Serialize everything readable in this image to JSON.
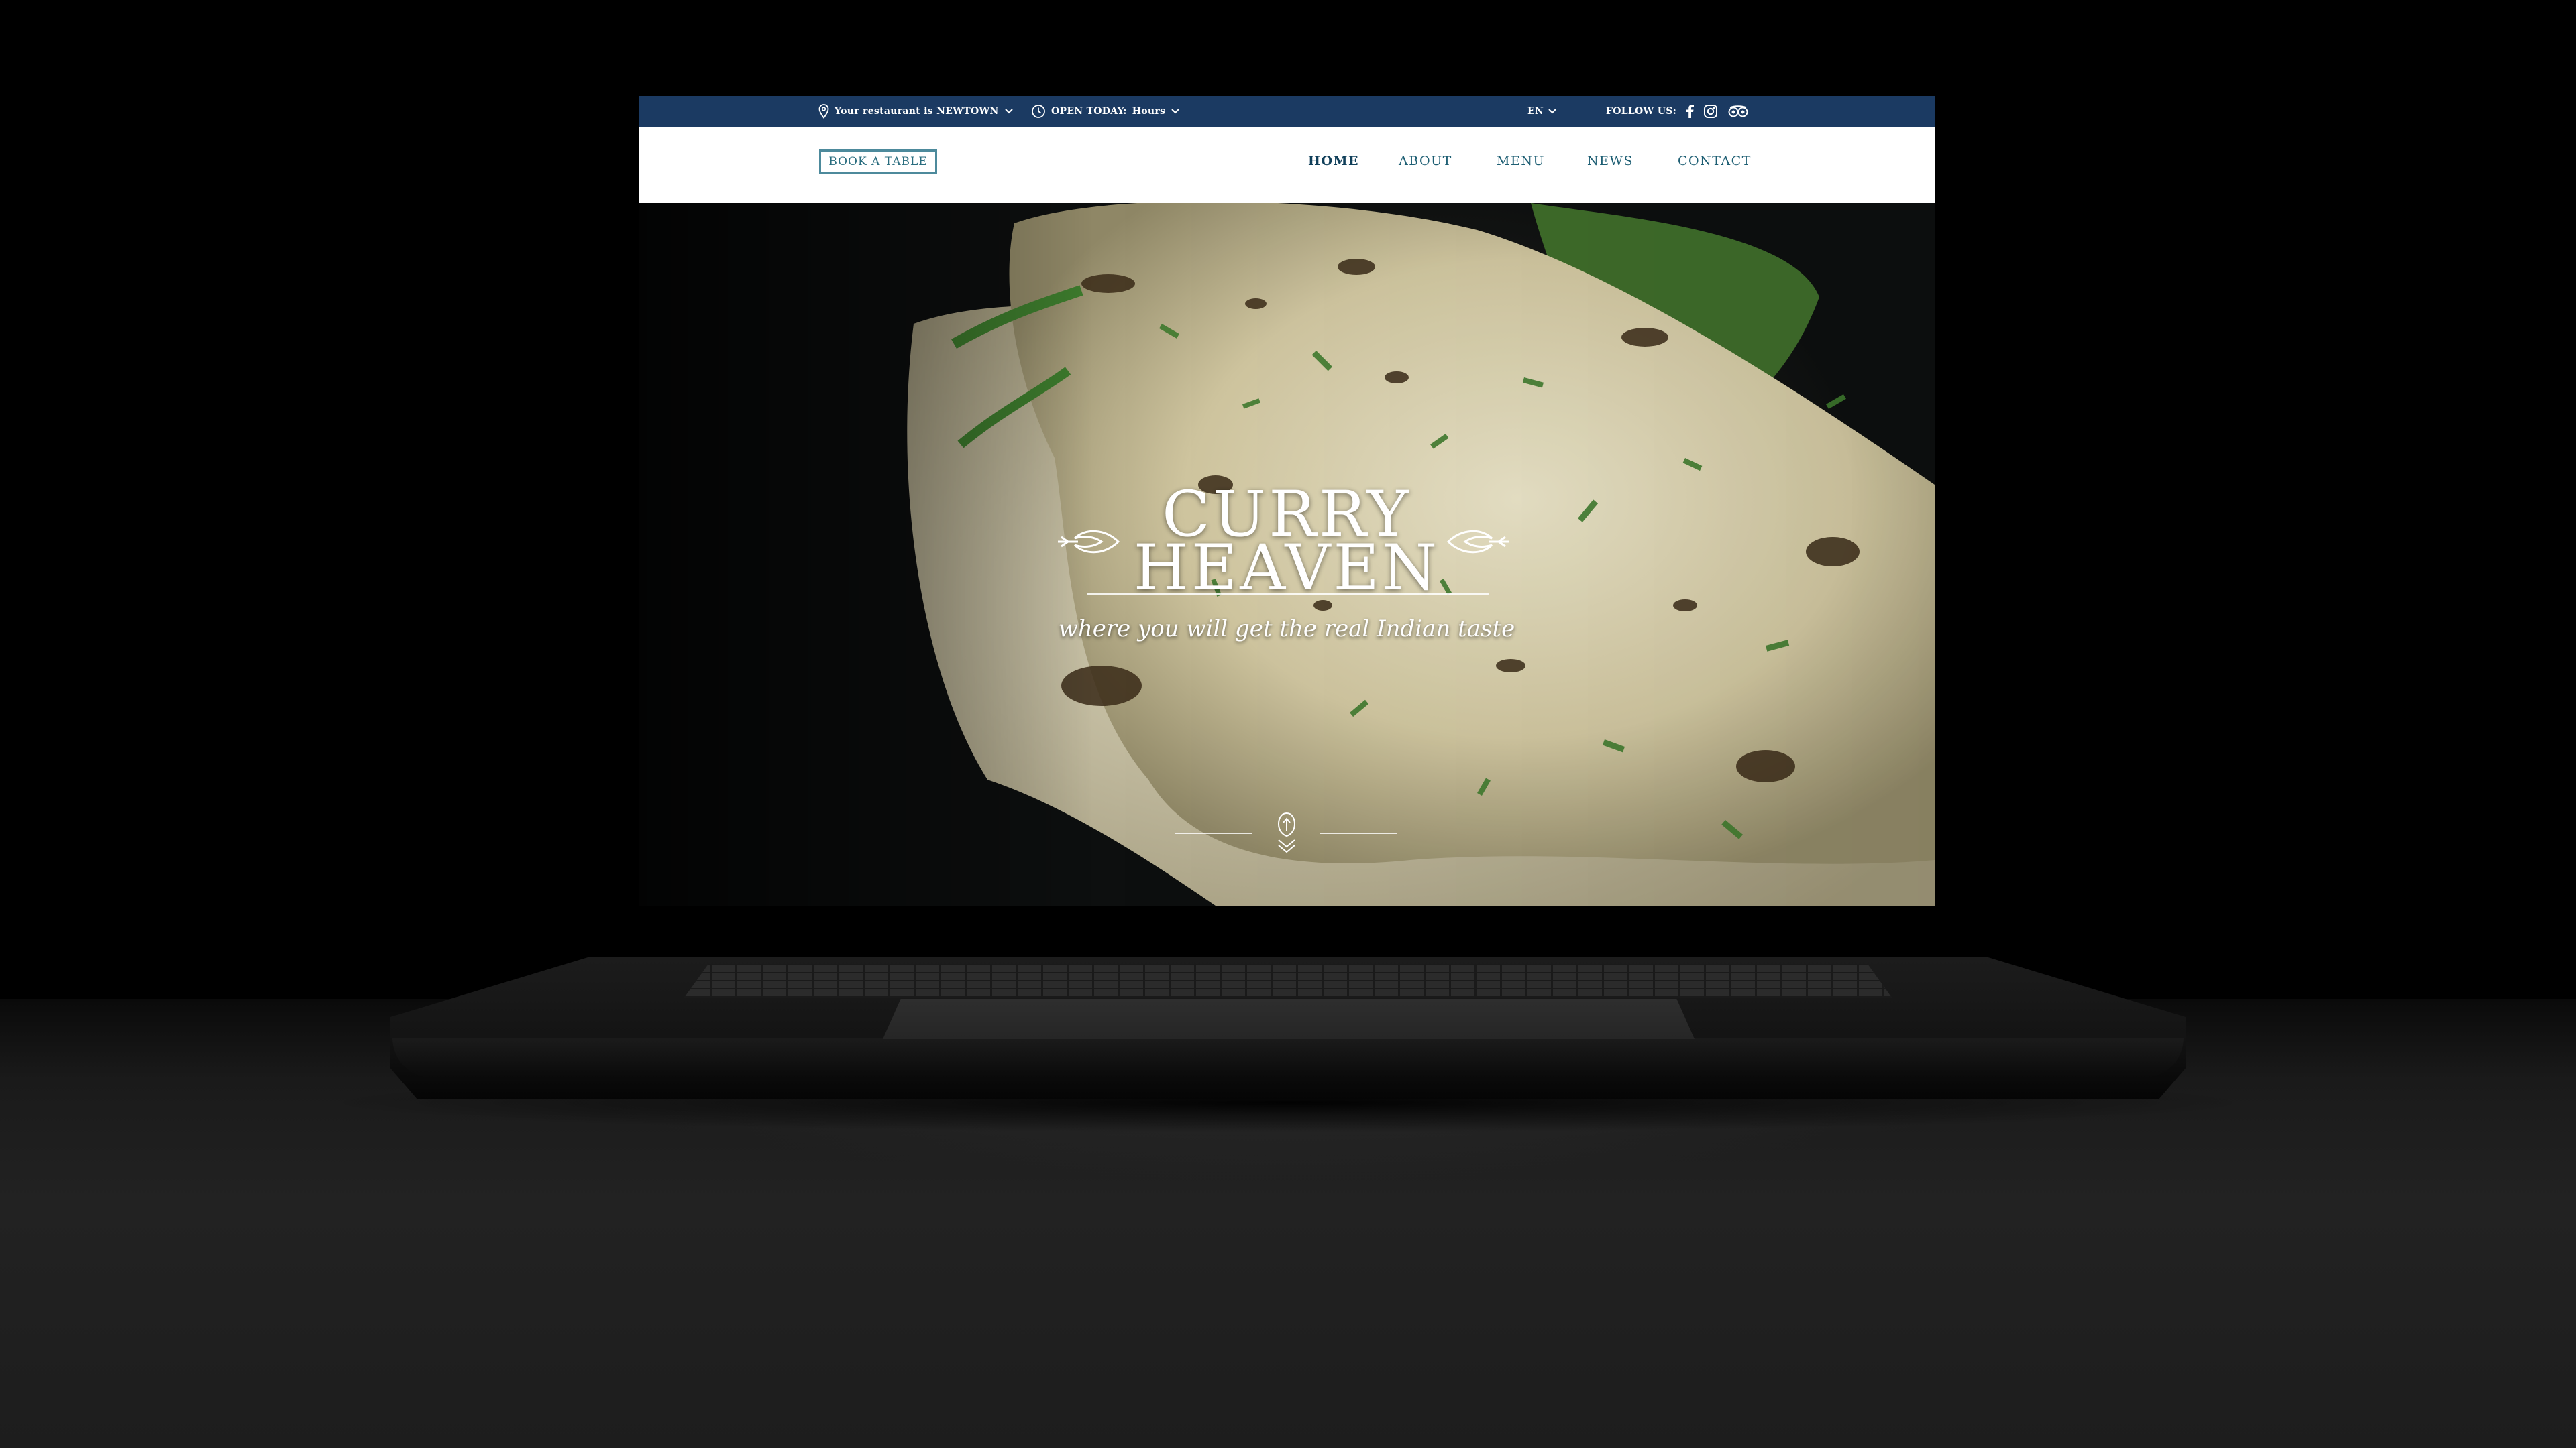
{
  "topbar": {
    "location_text": "Your restaurant is NEWTOWN",
    "hours_prefix": "OPEN TODAY:",
    "hours_value": "Hours",
    "language": "EN",
    "follow_label": "FOLLOW US:"
  },
  "navbar": {
    "book_button": "BOOK A TABLE",
    "links": [
      "HOME",
      "ABOUT",
      "MENU",
      "NEWS",
      "CONTACT"
    ],
    "active_link": "HOME"
  },
  "hero": {
    "brand_line1": "CURRY",
    "brand_line2": "HEAVEN",
    "tagline": "where you will get the real Indian taste"
  },
  "icons": {
    "location": "map-pin-icon",
    "clock": "clock-icon",
    "facebook": "facebook-icon",
    "instagram": "instagram-icon",
    "tripadvisor": "tripadvisor-icon",
    "scroll": "scroll-down-icon"
  },
  "colors": {
    "topbar_bg": "#1b3a62",
    "nav_text": "#1d5e73",
    "button_border": "#4d8a9c"
  }
}
